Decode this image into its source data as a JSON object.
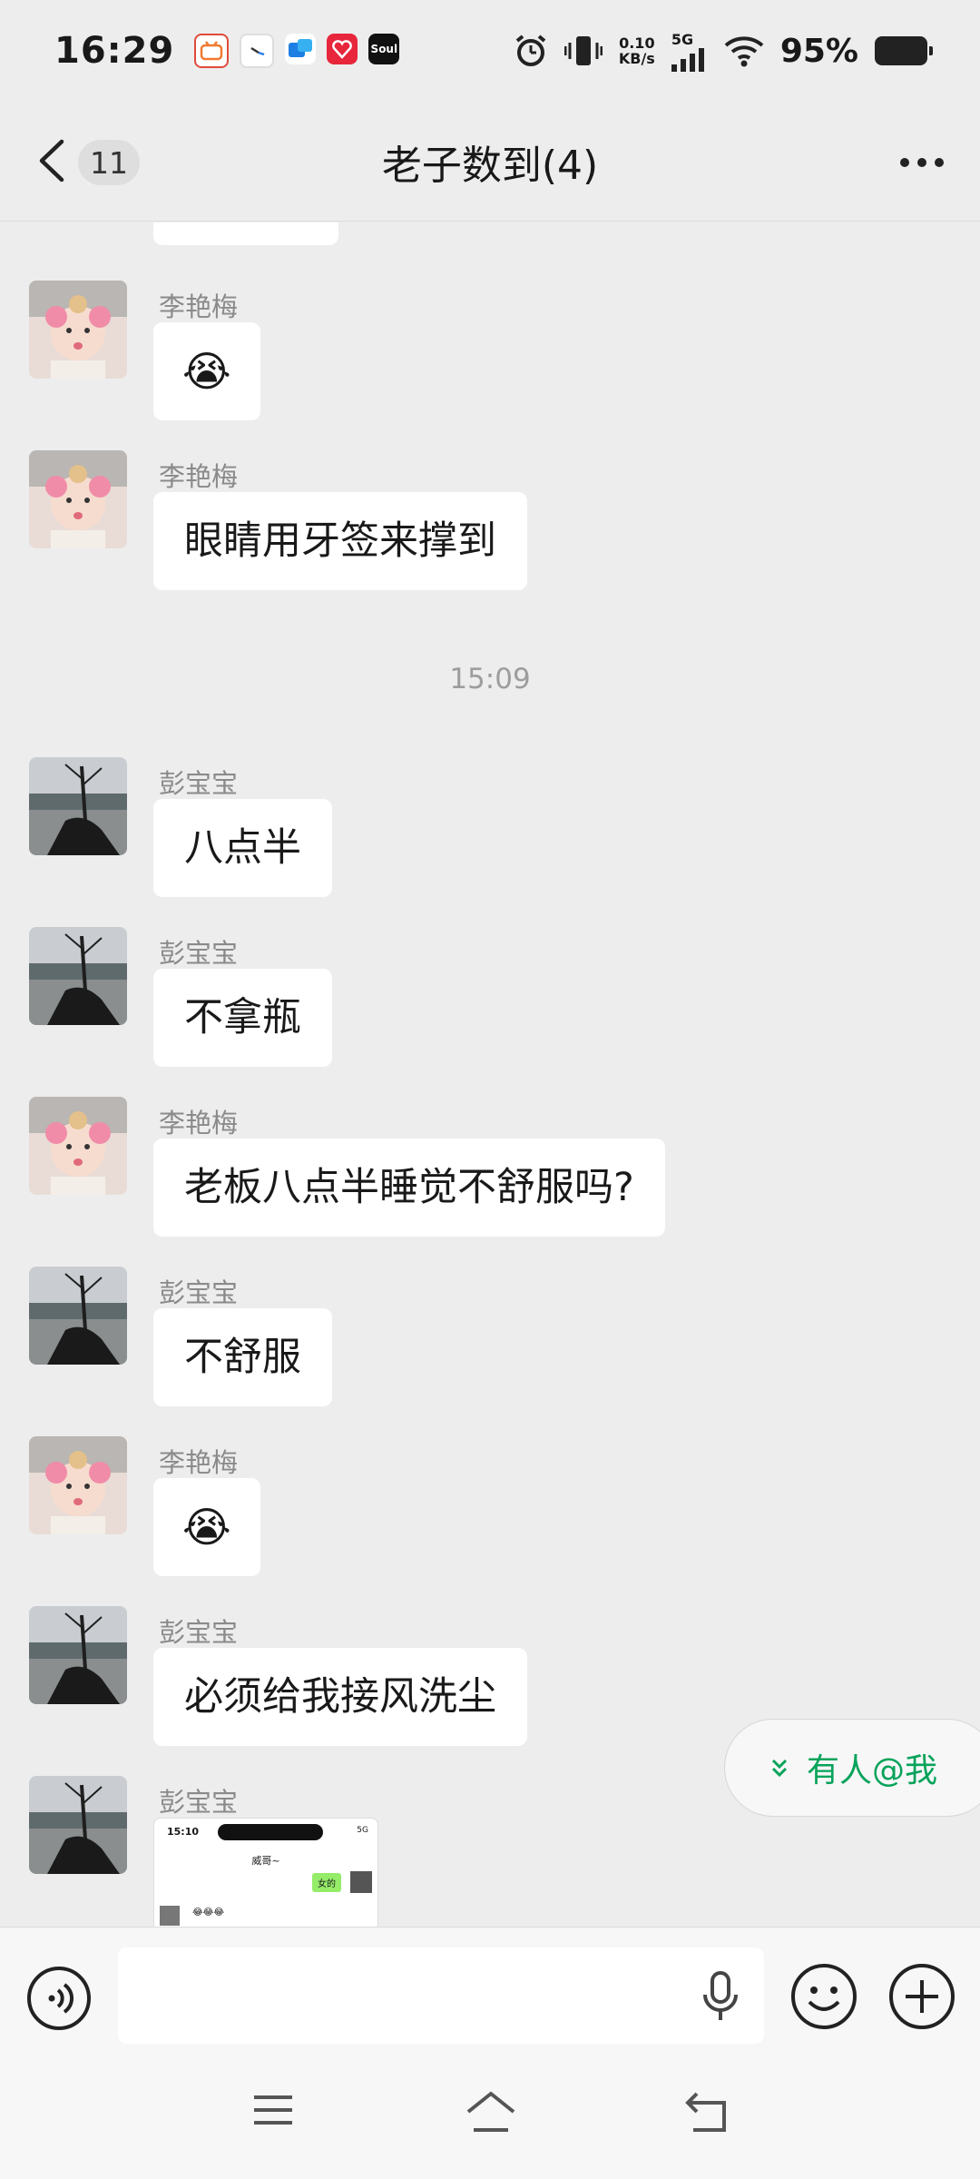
{
  "status_bar": {
    "time": "16:29",
    "app_icons": [
      "bilibili-icon",
      "clock-app-icon",
      "gallery-app-icon",
      "red-app-icon",
      "soul-app-icon"
    ],
    "soul_label": "Soul",
    "net_speed_value": "0.10",
    "net_speed_unit": "KB/s",
    "network": "5G",
    "battery": "95%"
  },
  "header": {
    "unread_count": "11",
    "title": "老子数到(4)"
  },
  "messages": [
    {
      "sender": "李艳梅",
      "content": "😭",
      "type": "emoji"
    },
    {
      "sender": "李艳梅",
      "content": "眼睛用牙签来撑到",
      "type": "text"
    },
    {
      "time": "15:09"
    },
    {
      "sender": "彭宝宝",
      "content": "八点半",
      "type": "text"
    },
    {
      "sender": "彭宝宝",
      "content": "不拿瓶",
      "type": "text"
    },
    {
      "sender": "李艳梅",
      "content": "老板八点半睡觉不舒服吗?",
      "type": "text"
    },
    {
      "sender": "彭宝宝",
      "content": "不舒服",
      "type": "text"
    },
    {
      "sender": "李艳梅",
      "content": "😭",
      "type": "emoji"
    },
    {
      "sender": "彭宝宝",
      "content": "必须给我接风洗尘",
      "type": "text"
    },
    {
      "sender": "彭宝宝",
      "type": "image",
      "image_preview": {
        "time": "15:10",
        "title": "威哥~",
        "bubble_text": "女的",
        "signal": "5G",
        "emojis": "😂😂😂"
      }
    }
  ],
  "at_me": {
    "label": "有人@我"
  },
  "input": {
    "placeholder": ""
  },
  "colors": {
    "background": "#ededed",
    "bubble": "#ffffff",
    "accent": "#07a35a"
  }
}
